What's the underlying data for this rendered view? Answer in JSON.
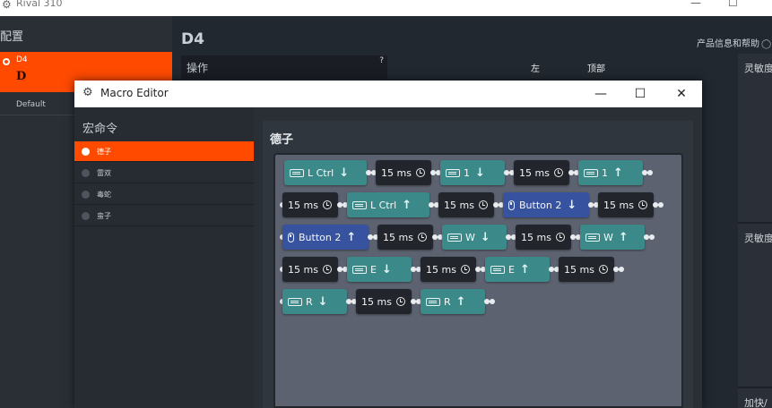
{
  "app": {
    "title": "Rival 310",
    "window_controls": [
      "—",
      "☐"
    ],
    "profiles_header": "配置",
    "profiles": [
      {
        "name": "D4",
        "icon_text": "D",
        "selected": true
      },
      {
        "name": "Default",
        "selected": false
      }
    ],
    "main_title": "D4",
    "help_link": "产品信息和帮助",
    "operation_label": "操作",
    "operation_help": "?",
    "column_left": "左",
    "column_top": "顶部",
    "right_labels": [
      "灵敏度",
      "灵敏度",
      "加快/"
    ]
  },
  "macro_editor": {
    "title": "Macro Editor",
    "controls": {
      "minimize": "—",
      "maximize": "☐",
      "close": "✕"
    },
    "list_header": "宏命令",
    "macros": [
      {
        "label": "德子",
        "selected": true
      },
      {
        "label": "雷双",
        "selected": false
      },
      {
        "label": "毒蛇",
        "selected": false
      },
      {
        "label": "蛮子",
        "selected": false
      }
    ],
    "selected_macro_name": "德子",
    "steps_rows": [
      [
        {
          "type": "key",
          "label": "L Ctrl",
          "dir": "down"
        },
        {
          "type": "delay",
          "label": "15 ms"
        },
        {
          "type": "key",
          "label": "1",
          "dir": "down"
        },
        {
          "type": "delay",
          "label": "15 ms"
        },
        {
          "type": "key",
          "label": "1",
          "dir": "up"
        }
      ],
      [
        {
          "type": "delay",
          "label": "15 ms"
        },
        {
          "type": "key",
          "label": "L Ctrl",
          "dir": "up"
        },
        {
          "type": "delay",
          "label": "15 ms"
        },
        {
          "type": "button",
          "label": "Button 2",
          "dir": "down"
        },
        {
          "type": "delay",
          "label": "15 ms"
        }
      ],
      [
        {
          "type": "button",
          "label": "Button 2",
          "dir": "up"
        },
        {
          "type": "delay",
          "label": "15 ms"
        },
        {
          "type": "key",
          "label": "W",
          "dir": "down"
        },
        {
          "type": "delay",
          "label": "15 ms"
        },
        {
          "type": "key",
          "label": "W",
          "dir": "up"
        }
      ],
      [
        {
          "type": "delay",
          "label": "15 ms"
        },
        {
          "type": "key",
          "label": "E",
          "dir": "down"
        },
        {
          "type": "delay",
          "label": "15 ms"
        },
        {
          "type": "key",
          "label": "E",
          "dir": "up"
        },
        {
          "type": "delay",
          "label": "15 ms"
        }
      ],
      [
        {
          "type": "key",
          "label": "R",
          "dir": "down"
        },
        {
          "type": "delay",
          "label": "15 ms"
        },
        {
          "type": "key",
          "label": "R",
          "dir": "up"
        }
      ]
    ],
    "colors": {
      "accent": "#ff4a00",
      "key_chip": "#3b8a89",
      "mouse_chip": "#37529e",
      "delay_chip": "#22262c"
    }
  }
}
